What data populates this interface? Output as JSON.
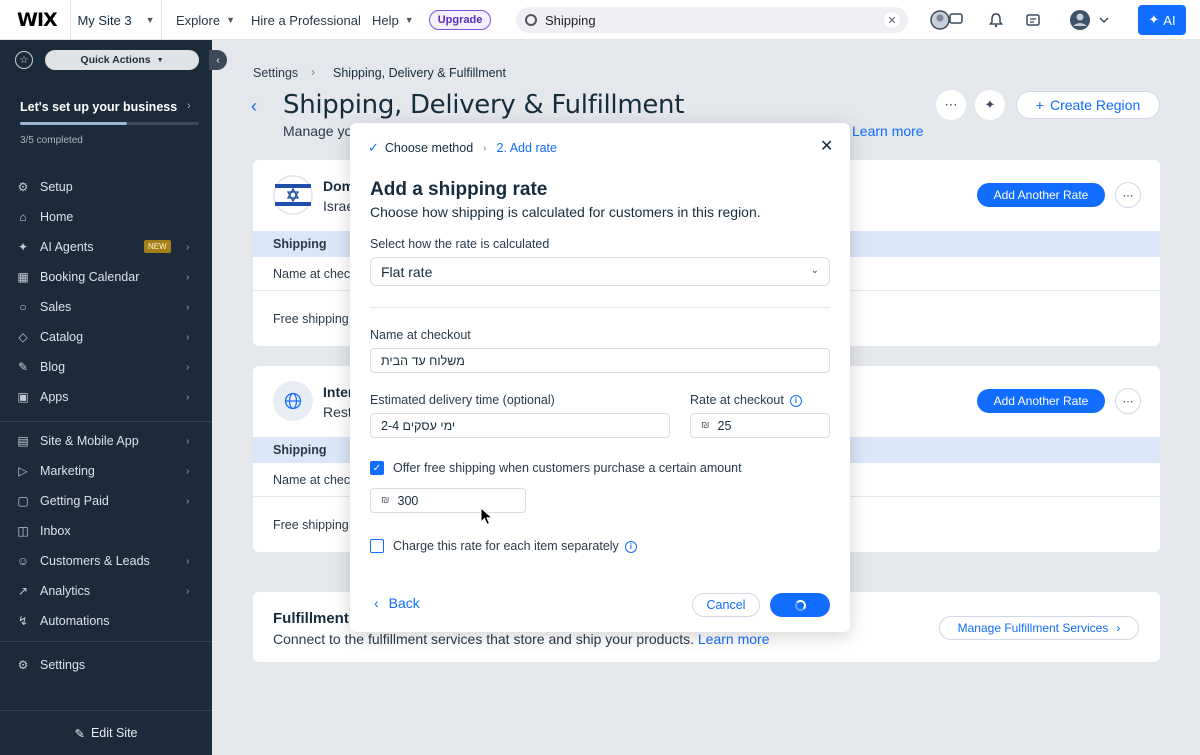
{
  "topbar": {
    "logo": "WIX",
    "site_name": "My Site 3",
    "nav": [
      "Explore",
      "Hire a Professional",
      "Help"
    ],
    "upgrade": "Upgrade",
    "search_value": "Shipping",
    "ai_label": "AI"
  },
  "sidebar": {
    "quick_actions": "Quick Actions",
    "setup_title": "Let's set up your business",
    "progress_fraction": 0.6,
    "progress_text": "3/5 completed",
    "items": [
      {
        "label": "Setup"
      },
      {
        "label": "Home"
      },
      {
        "label": "AI Agents",
        "badge": "NEW"
      },
      {
        "label": "Booking Calendar"
      },
      {
        "label": "Sales"
      },
      {
        "label": "Catalog"
      },
      {
        "label": "Blog"
      },
      {
        "label": "Apps"
      },
      {
        "label": "Site & Mobile App"
      },
      {
        "label": "Marketing"
      },
      {
        "label": "Getting Paid"
      },
      {
        "label": "Inbox"
      },
      {
        "label": "Customers & Leads"
      },
      {
        "label": "Analytics"
      },
      {
        "label": "Automations"
      },
      {
        "label": "Settings"
      }
    ],
    "edit_site": "Edit Site"
  },
  "page": {
    "breadcrumb_root": "Settings",
    "breadcrumb_current": "Shipping, Delivery & Fulfillment",
    "title": "Shipping, Delivery & Fulfillment",
    "subtitle": "Manage yo",
    "learn_more": "Learn more",
    "create_region": "Create Region",
    "region1": {
      "title": "Dom",
      "subtitle": "Israe",
      "add_rate": "Add Another Rate",
      "table_header": "Shipping",
      "row1": "Name at check",
      "row2": "Free shipping"
    },
    "region2": {
      "title": "Inter",
      "subtitle": "Rest",
      "add_rate": "Add Another Rate",
      "table_header": "Shipping",
      "row1": "Name at check",
      "row2": "Free shipping"
    },
    "fulfillment": {
      "title": "Fulfillment",
      "subtitle": "Connect to the fulfillment services that store and ship your products.",
      "learn_more": "Learn more",
      "manage": "Manage Fulfillment Services"
    }
  },
  "modal": {
    "step1": "Choose method",
    "step2": "2.  Add rate",
    "title": "Add a shipping rate",
    "subtitle": "Choose how shipping is calculated for customers in this region.",
    "calc_label": "Select how the rate is calculated",
    "calc_value": "Flat rate",
    "name_label": "Name at checkout",
    "name_value": "משלוח עד הבית",
    "delivery_label": "Estimated delivery time (optional)",
    "delivery_value": "2-4 ימי עסקים",
    "rate_label": "Rate at checkout",
    "currency_symbol": "₪",
    "rate_value": "25",
    "free_shipping_label": "Offer free shipping when customers purchase a certain amount",
    "free_shipping_checked": true,
    "free_amount": "300",
    "per_item_label": "Charge this rate for each item separately",
    "per_item_checked": false,
    "back": "Back",
    "cancel": "Cancel"
  },
  "colors": {
    "accent": "#116dff",
    "sidebar_bg": "#1c2b3a",
    "new_badge": "#a47e17"
  }
}
